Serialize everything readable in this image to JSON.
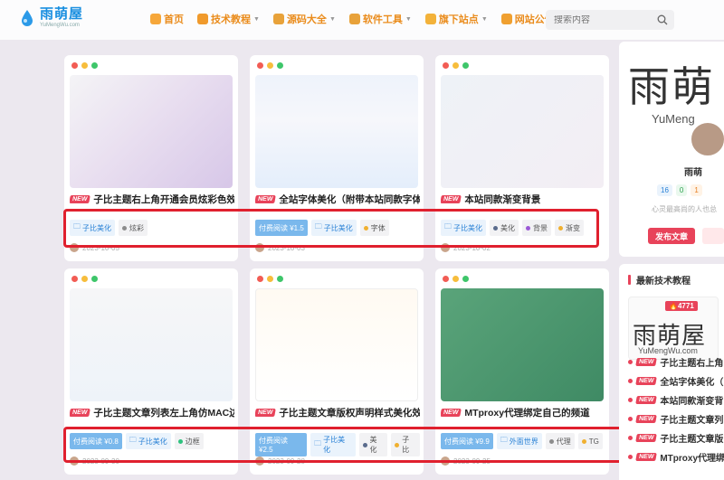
{
  "site": {
    "title": "雨萌屋",
    "subtitle": "YuMengWu.com"
  },
  "nav": [
    {
      "label": "首页",
      "icon": "home-icon",
      "color": "#f6a73a",
      "has_caret": false
    },
    {
      "label": "技术教程",
      "icon": "book-icon",
      "color": "#f09a2c",
      "has_caret": true
    },
    {
      "label": "源码大全",
      "icon": "code-icon",
      "color": "#e8a23a",
      "has_caret": true
    },
    {
      "label": "软件工具",
      "icon": "tool-icon",
      "color": "#e8a23a",
      "has_caret": true
    },
    {
      "label": "旗下站点",
      "icon": "site-icon",
      "color": "#f3b23a",
      "has_caret": true
    },
    {
      "label": "网站公告",
      "icon": "notice-icon",
      "color": "#f0a030",
      "has_caret": false
    }
  ],
  "search": {
    "placeholder": "搜索内容"
  },
  "cards": [
    {
      "title": "子比主题右上角开通会员炫彩色效果",
      "tags": [
        {
          "kind": "cat",
          "text": "子比美化"
        },
        {
          "kind": "plain",
          "text": "炫彩",
          "dot": "#8c8c8c"
        }
      ],
      "meta": "2023-10-05"
    },
    {
      "title": "全站字体美化（附带本站同款字体）",
      "tags": [
        {
          "kind": "paid",
          "text": "付费阅读 ¥1.5"
        },
        {
          "kind": "cat",
          "text": "子比美化"
        },
        {
          "kind": "plain",
          "text": "字体",
          "dot": "#f0b030"
        }
      ],
      "meta": "2023-10-03"
    },
    {
      "title": "本站同款渐变背景",
      "tags": [
        {
          "kind": "cat",
          "text": "子比美化"
        },
        {
          "kind": "plain",
          "text": "美化",
          "dot": "#5a6b8c"
        },
        {
          "kind": "plain",
          "text": "背景",
          "dot": "#9b59d6"
        },
        {
          "kind": "plain",
          "text": "渐变",
          "dot": "#f0b030"
        }
      ],
      "meta": "2023-10-02"
    },
    {
      "title": "子比主题文章列表左上角仿MAC边框美化",
      "tags": [
        {
          "kind": "paid",
          "text": "付费阅读 ¥0.8"
        },
        {
          "kind": "cat",
          "text": "子比美化"
        },
        {
          "kind": "plain",
          "text": "边框",
          "dot": "#2ec27e"
        }
      ],
      "meta": "2023-09-30"
    },
    {
      "title": "子比主题文章版权声明样式美化效果（二开）",
      "tags": [
        {
          "kind": "paid",
          "text": "付费阅读 ¥2.5"
        },
        {
          "kind": "cat",
          "text": "子比美化"
        },
        {
          "kind": "plain",
          "text": "美化",
          "dot": "#5a6b8c"
        },
        {
          "kind": "plain",
          "text": "子比",
          "dot": "#f0b030"
        }
      ],
      "meta": "2023-09-28"
    },
    {
      "title": "MTproxy代理绑定自己的频道",
      "tags": [
        {
          "kind": "paid",
          "text": "付费阅读 ¥9.9"
        },
        {
          "kind": "cat",
          "text": "外面世界"
        },
        {
          "kind": "plain",
          "text": "代理",
          "dot": "#8c8c8c"
        },
        {
          "kind": "plain",
          "text": "TG",
          "dot": "#f0b030"
        }
      ],
      "meta": "2023-09-25"
    }
  ],
  "profile": {
    "logo_text": "雨萌",
    "logo_sub": "YuMeng",
    "name": "雨萌",
    "stats": [
      "16",
      "0",
      "1"
    ],
    "motto": "心灵最高尚的人也总",
    "publish": "发布文章"
  },
  "latest": {
    "heading": "最新技术教程",
    "hot": "4771",
    "thumb_text": "雨萌屋",
    "thumb_sub": "YuMengWu.com",
    "items": [
      "子比主题右上角",
      "全站字体美化（",
      "本站同款渐变背",
      "子比主题文章列",
      "子比主题文章版",
      "MTproxy代理绑"
    ]
  },
  "colors": {
    "accent": "#e8435a",
    "highlight": "#e0202e",
    "brand": "#1a8fe0"
  }
}
